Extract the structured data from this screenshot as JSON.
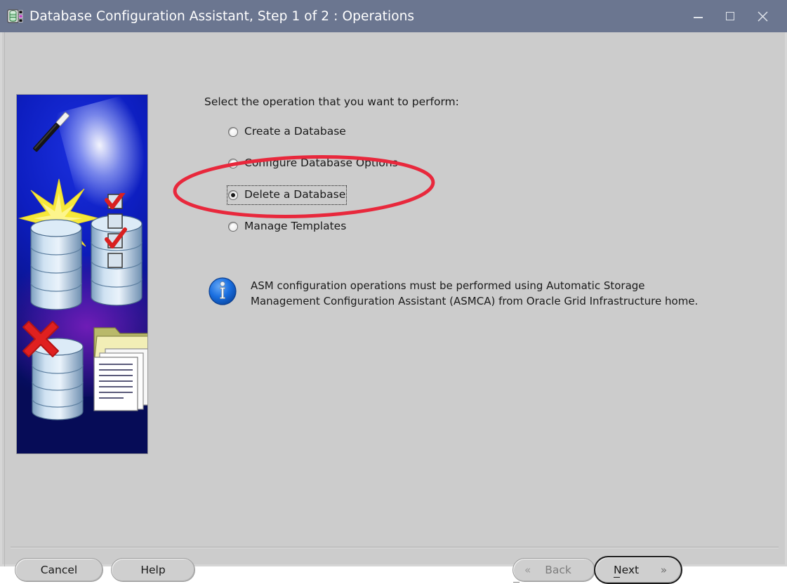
{
  "window": {
    "title": "Database Configuration Assistant, Step 1 of 2 : Operations",
    "icon": "database-wizard-icon",
    "titlebar_color": "#6b7690",
    "background_color": "#cccccc",
    "controls": {
      "minimize": "minimize-icon",
      "maximize": "maximize-icon",
      "close": "close-icon"
    }
  },
  "banner": {
    "alt": "Oracle DBCA illustration: magic wand, sparkle, database cylinders, red X, folder and documents"
  },
  "main": {
    "prompt": "Select the operation that you want to perform:",
    "options": [
      {
        "label": "Create a Database",
        "selected": false,
        "focused": false
      },
      {
        "label": "Configure Database Options",
        "selected": false,
        "focused": false
      },
      {
        "label": "Delete a Database",
        "selected": true,
        "focused": true
      },
      {
        "label": "Manage Templates",
        "selected": false,
        "focused": false
      }
    ],
    "note": {
      "icon": "info-icon",
      "icon_color": "#1d6fe0",
      "text": "ASM configuration operations must be performed using Automatic Storage\nManagement Configuration Assistant (ASMCA) from Oracle Grid Infrastructure home."
    }
  },
  "annotation": {
    "shape": "red-ellipse-highlight",
    "color": "#e8283c",
    "targets": "Delete a Database"
  },
  "footer": {
    "cancel_label": "Cancel",
    "help_label": "Help",
    "back_label": "Back",
    "back_chevron": "«",
    "back_enabled": false,
    "next_label": "Next",
    "next_chevron": "»",
    "next_default": true
  }
}
